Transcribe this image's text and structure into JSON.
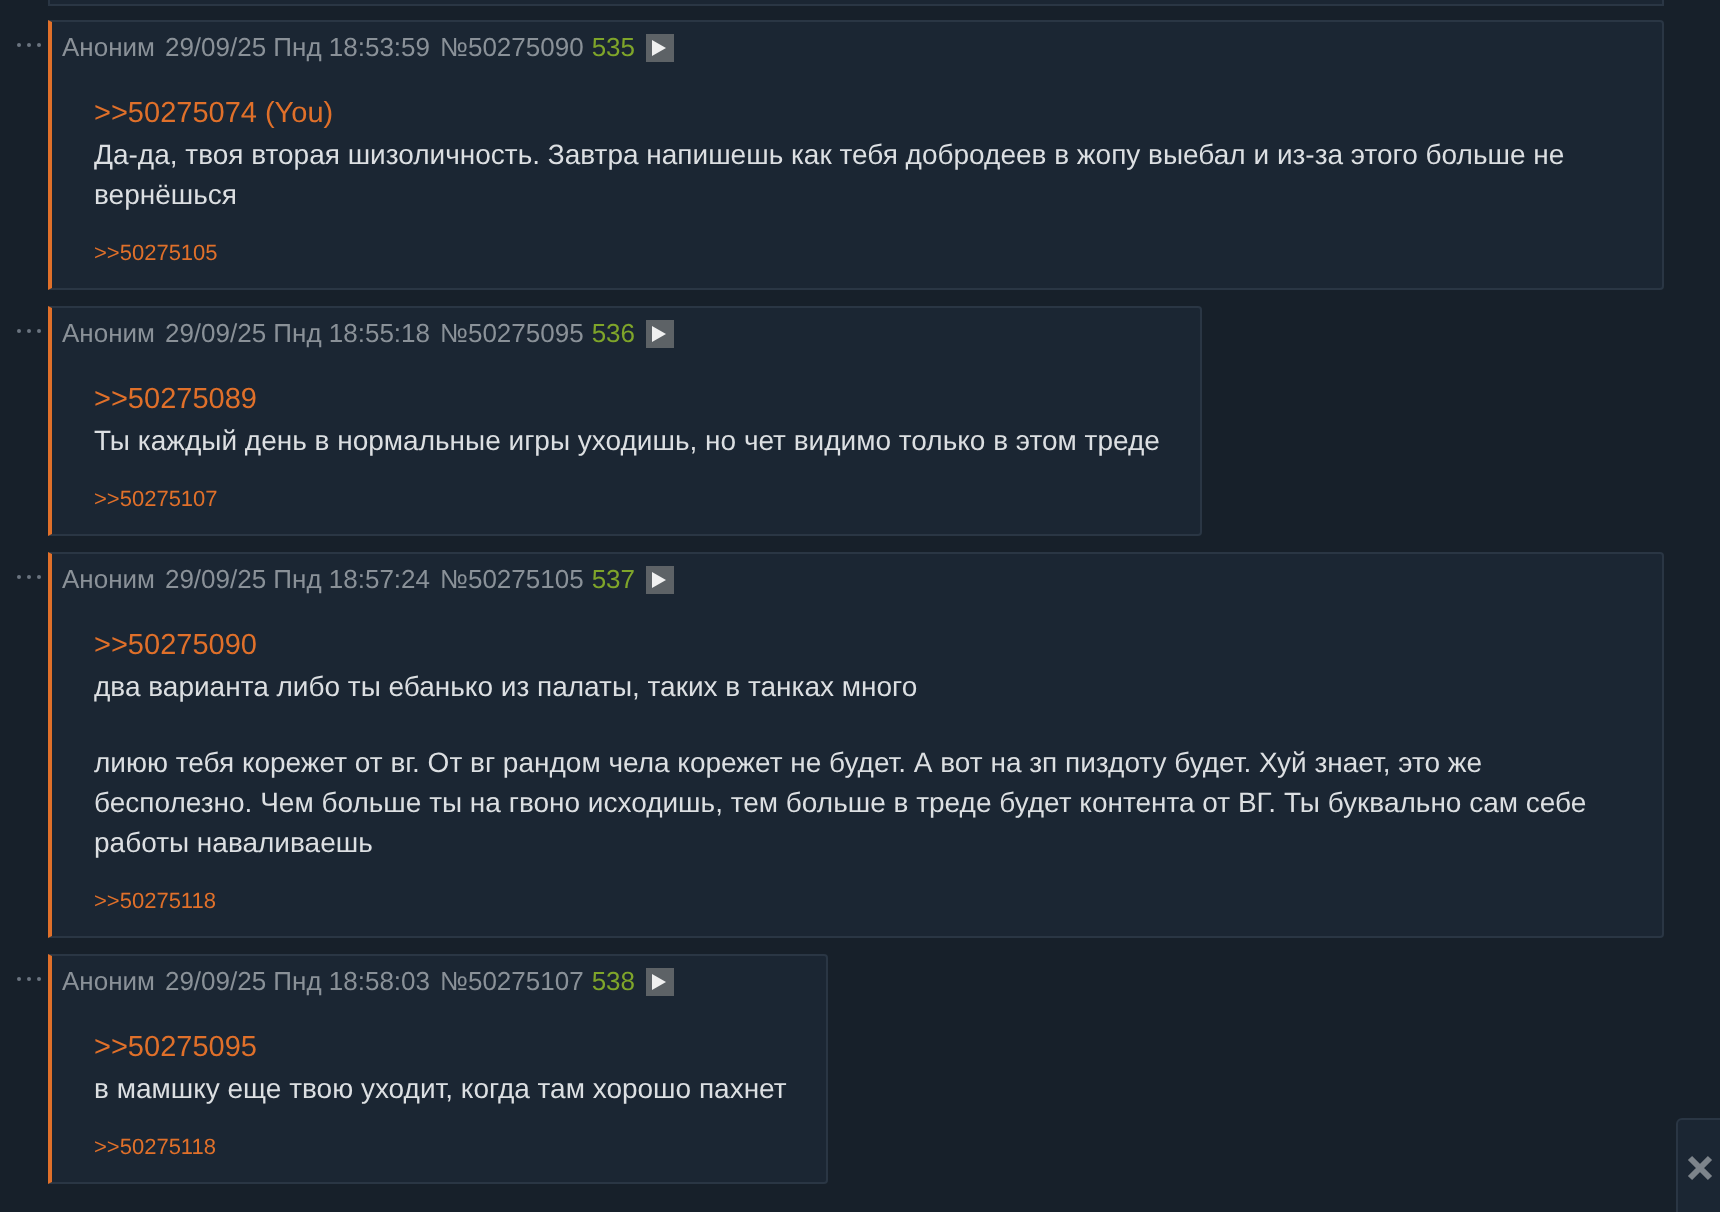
{
  "posts": [
    {
      "name": "Аноним",
      "date": "29/09/25 Пнд 18:53:59",
      "number": "№50275090",
      "count": "535",
      "reply_to": ">>50275074 (You)",
      "paragraphs": [
        "Да-да, твоя вторая шизоличность. Завтра напишешь как тебя добродеев в жопу выебал и из-за этого больше не вернёшься"
      ],
      "replies": [
        ">>50275105"
      ]
    },
    {
      "name": "Аноним",
      "date": "29/09/25 Пнд 18:55:18",
      "number": "№50275095",
      "count": "536",
      "reply_to": ">>50275089",
      "paragraphs": [
        "Ты каждый день в нормальные игры уходишь, но чет видимо только в этом треде"
      ],
      "replies": [
        ">>50275107"
      ]
    },
    {
      "name": "Аноним",
      "date": "29/09/25 Пнд 18:57:24",
      "number": "№50275105",
      "count": "537",
      "reply_to": ">>50275090",
      "paragraphs": [
        "два варианта либо ты ебанько из палаты, таких в танках много",
        "лиюю тебя корежет от вг. От вг рандом чела корежет не будет. А вот на зп пиздоту будет. Хуй знает, это же бесполезно. Чем больше ты на гвоно исходишь, тем больше в треде будет контента от ВГ. Ты буквально сам себе работы наваливаешь"
      ],
      "replies": [
        ">>50275118"
      ]
    },
    {
      "name": "Аноним",
      "date": "29/09/25 Пнд 18:58:03",
      "number": "№50275107",
      "count": "538",
      "reply_to": ">>50275095",
      "paragraphs": [
        "в мамшку еще твою уходит, когда там хорошо пахнет"
      ],
      "replies": [
        ">>50275118"
      ]
    }
  ]
}
